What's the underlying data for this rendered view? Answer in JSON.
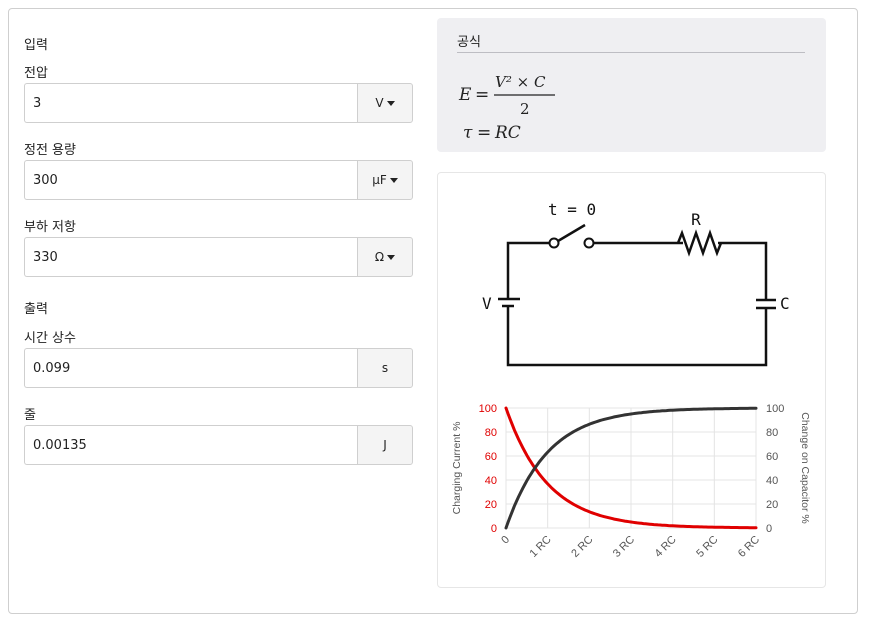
{
  "inputs": {
    "section_label": "입력",
    "voltage": {
      "label": "전압",
      "value": "3",
      "unit": "V"
    },
    "capacitance": {
      "label": "정전 용량",
      "value": "300",
      "unit": "μF"
    },
    "resistance": {
      "label": "부하 저항",
      "value": "330",
      "unit": "Ω"
    }
  },
  "outputs": {
    "section_label": "출력",
    "time_constant": {
      "label": "시간 상수",
      "value": "0.099",
      "unit": "s"
    },
    "energy": {
      "label": "줄",
      "value": "0.00135",
      "unit": "J"
    }
  },
  "formula": {
    "title": "공식",
    "energy_lhs": "E",
    "energy_numerator": "V² × C",
    "energy_denominator": "2",
    "tau_lhs": "τ",
    "tau_rhs": "RC"
  },
  "circuit": {
    "switch_label": "t = 0",
    "resistor_label": "R",
    "battery_label": "V",
    "capacitor_label": "C"
  },
  "chart_data": {
    "type": "line",
    "x_ticks": [
      "0",
      "1 RC",
      "2 RC",
      "3 RC",
      "4 RC",
      "5 RC",
      "6 RC"
    ],
    "ylabel_left": "Charging Current %",
    "ylabel_right": "Change on Capacitor %",
    "y_ticks": [
      "0",
      "20",
      "40",
      "60",
      "80",
      "100"
    ],
    "ylim": [
      0,
      100
    ],
    "xlim": [
      0,
      6
    ],
    "grid": true,
    "series": [
      {
        "color": "#e00000",
        "x": [
          0,
          0.25,
          0.5,
          0.75,
          1,
          1.5,
          2,
          2.5,
          3,
          3.5,
          4,
          5,
          6
        ],
        "values": [
          100,
          77.9,
          60.7,
          47.2,
          36.8,
          22.3,
          13.5,
          8.2,
          5.0,
          3.0,
          1.8,
          0.7,
          0.2
        ]
      },
      {
        "color": "#333333",
        "x": [
          0,
          0.25,
          0.5,
          0.75,
          1,
          1.5,
          2,
          2.5,
          3,
          3.5,
          4,
          5,
          6
        ],
        "values": [
          0,
          22.1,
          39.3,
          52.8,
          63.2,
          77.7,
          86.5,
          91.8,
          95.0,
          97.0,
          98.2,
          99.3,
          99.8
        ]
      }
    ]
  }
}
